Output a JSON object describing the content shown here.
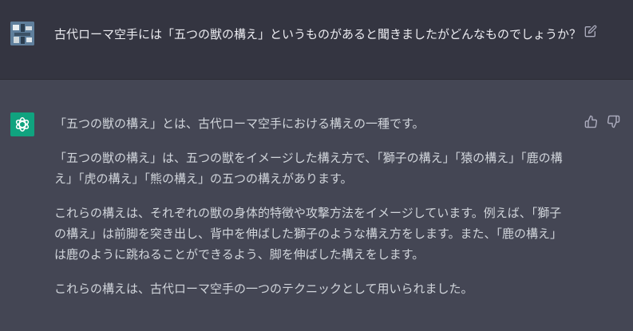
{
  "user_message": {
    "text": "古代ローマ空手には「五つの獣の構え」というものがあると聞きましたがどんなものでしょうか？"
  },
  "assistant_message": {
    "paragraphs": [
      "「五つの獣の構え」とは、古代ローマ空手における構えの一種です。",
      "「五つの獣の構え」は、五つの獣をイメージした構え方で、「獅子の構え」「猿の構え」「鹿の構え」「虎の構え」「熊の構え」の五つの構えがあります。",
      "これらの構えは、それぞれの獣の身体的特徴や攻撃方法をイメージしています。例えば、「獅子の構え」は前脚を突き出し、背中を伸ばした獅子のような構え方をします。また、「鹿の構え」は鹿のように跳ねることができるよう、脚を伸ばした構えをします。",
      "これらの構えは、古代ローマ空手の一つのテクニックとして用いられました。"
    ]
  },
  "icons": {
    "user_avatar": "user-avatar-image",
    "assistant_avatar": "openai-logo-icon",
    "edit": "edit-icon",
    "thumbs_up": "thumbs-up-icon",
    "thumbs_down": "thumbs-down-icon"
  },
  "colors": {
    "user_bg": "#343541",
    "assistant_bg": "#444654",
    "accent": "#10a37f",
    "text": "#ececf1",
    "answer_text": "#d1d5db",
    "icon": "#acacbe"
  }
}
